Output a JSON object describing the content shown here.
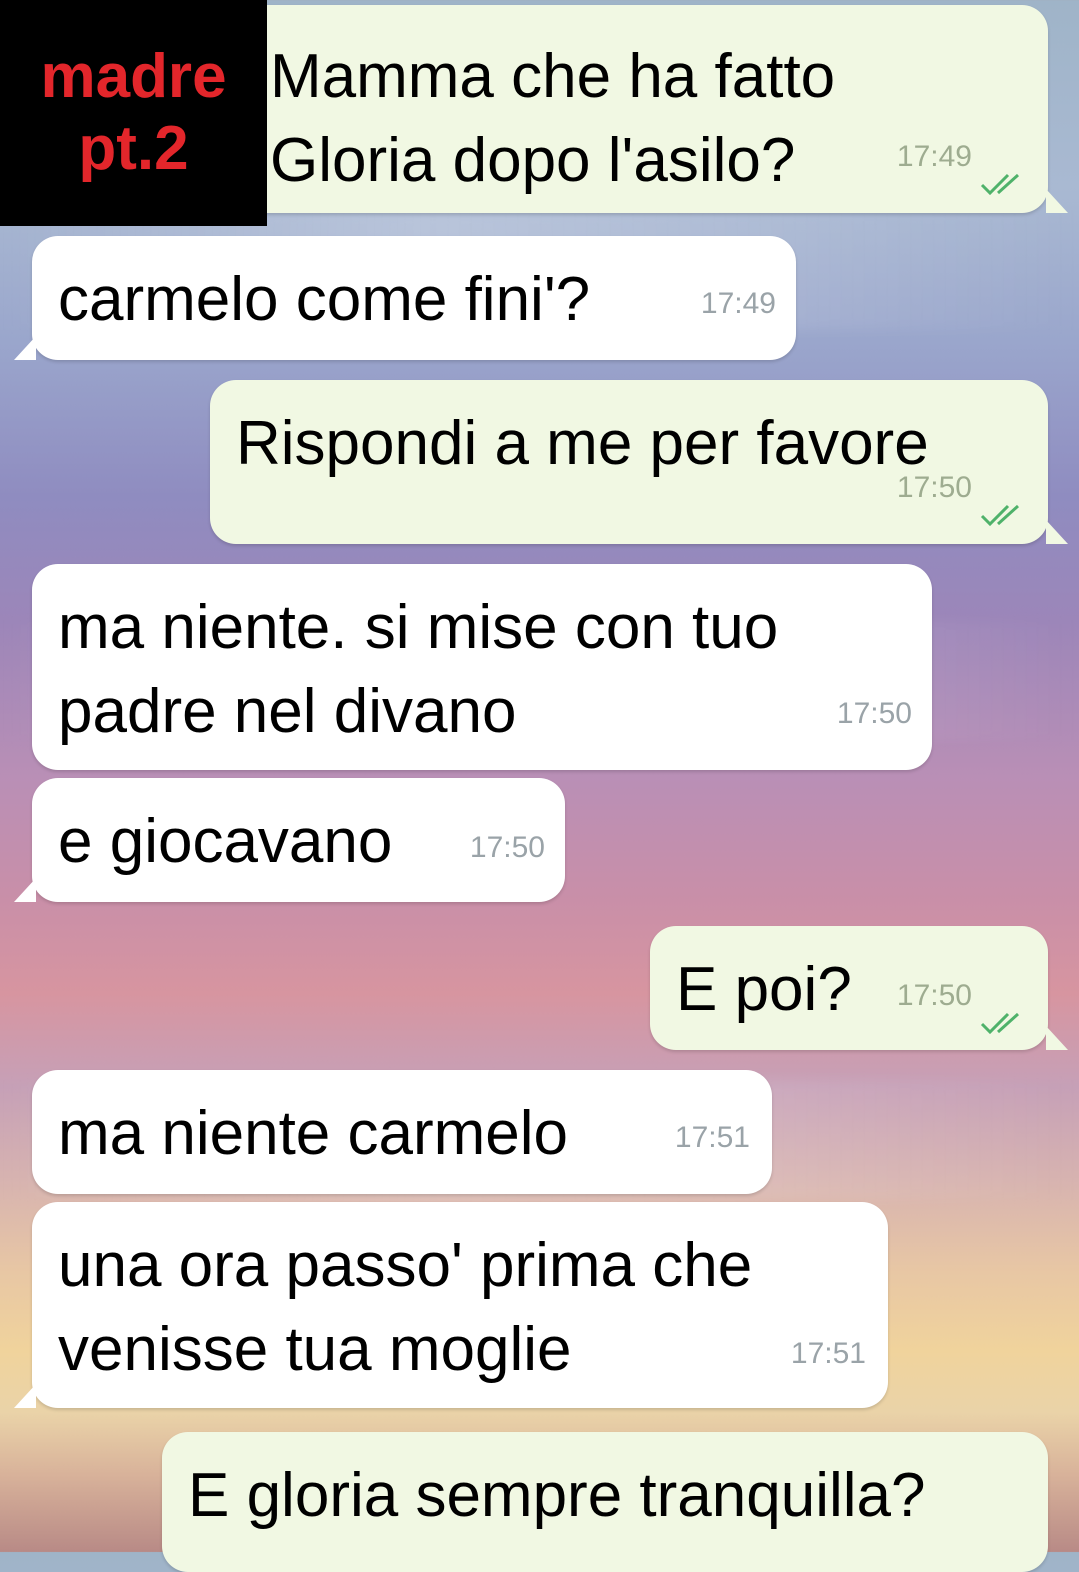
{
  "overlay_label": {
    "line1": "madre",
    "line2": "pt.2",
    "color": "#e3262b"
  },
  "messages": [
    {
      "direction": "outgoing",
      "text": "Mamma che ha fatto\nGloria dopo l'asilo?",
      "time": "17:49",
      "read": true
    },
    {
      "direction": "incoming",
      "text": "carmelo come fini'?",
      "time": "17:49"
    },
    {
      "direction": "outgoing",
      "text": "Rispondi a me per favore",
      "time": "17:50",
      "read": true
    },
    {
      "direction": "incoming",
      "text": "ma niente. si mise con tuo\npadre nel divano",
      "time": "17:50"
    },
    {
      "direction": "incoming",
      "text": "e giocavano",
      "time": "17:50"
    },
    {
      "direction": "outgoing",
      "text": "E poi?",
      "time": "17:50",
      "read": true
    },
    {
      "direction": "incoming",
      "text": "ma niente carmelo",
      "time": "17:51"
    },
    {
      "direction": "incoming",
      "text": "una ora passo' prima che\nvenisse tua moglie",
      "time": "17:51"
    },
    {
      "direction": "outgoing",
      "text": "E gloria sempre tranquilla?",
      "time": "",
      "read": false
    }
  ],
  "colors": {
    "incoming_bubble": "#ffffff",
    "outgoing_bubble": "#f1f8e3",
    "read_ticks": "#4fb26a",
    "timestamp": "#9aa3a8"
  }
}
